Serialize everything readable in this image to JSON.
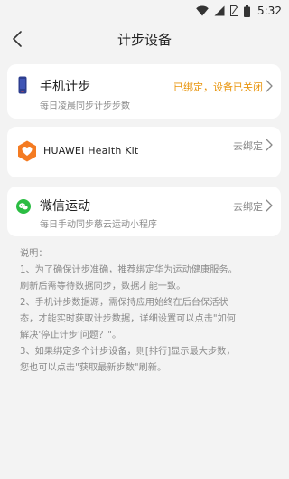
{
  "status_bar": {
    "time": "5:32"
  },
  "header": {
    "title": "计步设备"
  },
  "devices": [
    {
      "title": "手机计步",
      "subtitle": "每日凌晨同步计步步数",
      "status": "已绑定，设备已关闭"
    },
    {
      "title": "HUAWEI Health Kit",
      "status": "去绑定"
    },
    {
      "title": "微信运动",
      "subtitle": "每日手动同步慈云运动小程序",
      "status": "去绑定"
    }
  ],
  "notes": {
    "heading": "说明：",
    "lines": [
      "1、为了确保计步准确，推荐绑定华为运动健康服务。",
      "刷新后需等待数据同步，数据才能一致。",
      "2、手机计步数据源，需保持应用始终在后台保活状",
      "态，才能实时获取计步数据，详细设置可以点击\"如何",
      "解决'停止计步'问题？\"。",
      "3、如果绑定多个计步设备，则[排行]显示最大步数，",
      "您也可以点击\"获取最新步数\"刷新。"
    ]
  },
  "colors": {
    "accent_warning": "#e8940c",
    "huawei_orange": "#f47b22",
    "wechat_green": "#2bbd43",
    "phone_blue": "#2d3e8f"
  },
  "icons": [
    "wifi-icon",
    "signal-icon",
    "sim-icon",
    "battery-icon",
    "back-arrow-icon",
    "phone-icon",
    "huawei-health-icon",
    "wechat-icon",
    "chevron-right-icon"
  ]
}
